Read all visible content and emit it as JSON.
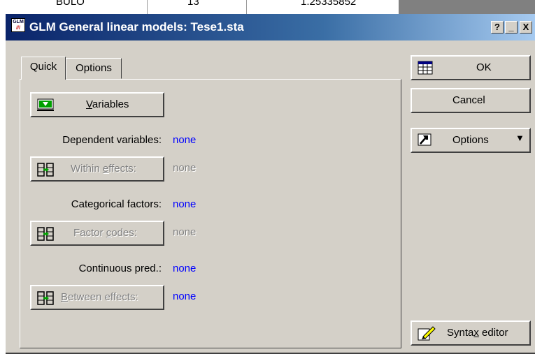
{
  "background": {
    "cell_texts": [
      "BULO",
      "13",
      "1.25335852"
    ]
  },
  "window": {
    "title": "GLM General linear models: Tese1.sta",
    "icon_text_top": "GLM",
    "icon_text_bottom": "///",
    "caption_buttons": {
      "help": "?",
      "minimize": "_",
      "close": "X"
    }
  },
  "tabs": [
    {
      "label": "Quick",
      "active": true
    },
    {
      "label": "Options",
      "active": false
    }
  ],
  "quick": {
    "variables_button": {
      "pre": "",
      "accel": "V",
      "post": "ariables"
    },
    "dependent": {
      "label": "Dependent variables:",
      "value": "none"
    },
    "within_button": {
      "pre": "Within ",
      "accel": "e",
      "post": "ffects:",
      "value": "none",
      "enabled": false
    },
    "categorical": {
      "label": "Categorical factors:",
      "value": "none"
    },
    "factor_codes_button": {
      "pre": "Factor ",
      "accel": "c",
      "post": "odes:",
      "value": "none",
      "enabled": false
    },
    "continuous": {
      "label": "Continuous pred.:",
      "value": "none"
    },
    "between_button": {
      "pre": "",
      "accel": "B",
      "post": "etween effects:",
      "value": "none",
      "enabled": false
    }
  },
  "side_buttons": {
    "ok": "OK",
    "cancel": "Cancel",
    "options": "Options",
    "syntax": {
      "pre": "Synta",
      "accel": "x",
      "post": " editor"
    }
  },
  "colors": {
    "face": "#d4d0c8",
    "title_start": "#0a246a",
    "title_end": "#a6caf0",
    "value_blue": "#0000ff",
    "disabled_text": "#808080"
  }
}
